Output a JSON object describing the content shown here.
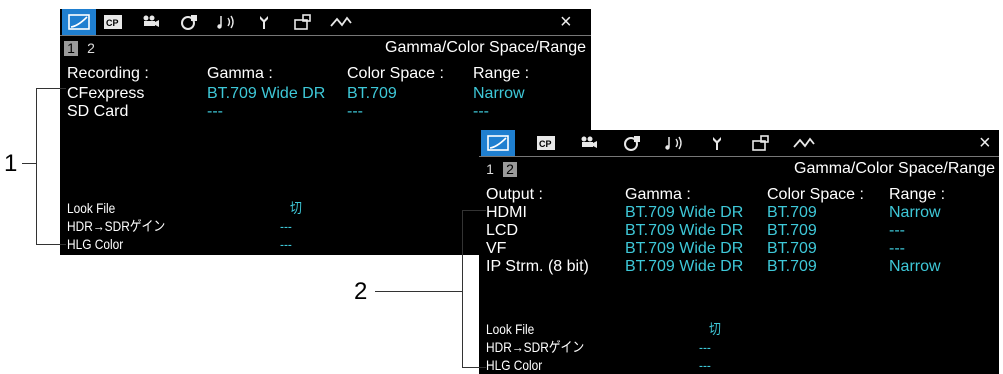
{
  "menu_tabs": [
    "gamma-icon",
    "cp-icon",
    "camera-icon",
    "video-icon",
    "audio-icon",
    "tool-icon",
    "assign-icon",
    "network-icon"
  ],
  "close_glyph": "×",
  "screen1": {
    "pages": [
      "1",
      "2"
    ],
    "title": "Gamma/Color Space/Range",
    "headers": {
      "label": "Recording :",
      "gamma": "Gamma :",
      "color_space": "Color Space :",
      "range": "Range :"
    },
    "rows": [
      {
        "label": "CFexpress",
        "gamma": "BT.709 Wide DR",
        "color_space": "BT.709",
        "range": "Narrow"
      },
      {
        "label": "SD Card",
        "gamma": "---",
        "color_space": "---",
        "range": "---"
      }
    ],
    "look_file": {
      "label": "Look File",
      "value": "切"
    },
    "hdr_gain": {
      "label": "HDR→SDRゲイン",
      "value": "---"
    },
    "hlg_color": {
      "label": "HLG Color",
      "value": "---"
    }
  },
  "screen2": {
    "pages": [
      "1",
      "2"
    ],
    "title": "Gamma/Color Space/Range",
    "headers": {
      "label": "Output :",
      "gamma": "Gamma :",
      "color_space": "Color Space :",
      "range": "Range :"
    },
    "rows": [
      {
        "label": "HDMI",
        "gamma": "BT.709 Wide DR",
        "color_space": "BT.709",
        "range": "Narrow"
      },
      {
        "label": "LCD",
        "gamma": "BT.709 Wide DR",
        "color_space": "BT.709",
        "range": "---"
      },
      {
        "label": "VF",
        "gamma": "BT.709 Wide DR",
        "color_space": "BT.709",
        "range": "---"
      },
      {
        "label": "IP Strm. (8 bit)",
        "gamma": "BT.709 Wide DR",
        "color_space": "BT.709",
        "range": "Narrow"
      }
    ],
    "look_file": {
      "label": "Look File",
      "value": "切"
    },
    "hdr_gain": {
      "label": "HDR→SDRゲイン",
      "value": "---"
    },
    "hlg_color": {
      "label": "HLG Color",
      "value": "---"
    }
  },
  "callouts": [
    "1",
    "2"
  ],
  "colors": {
    "accent": "#1f7fd0",
    "value": "#3ec8d8",
    "background": "#000000"
  }
}
